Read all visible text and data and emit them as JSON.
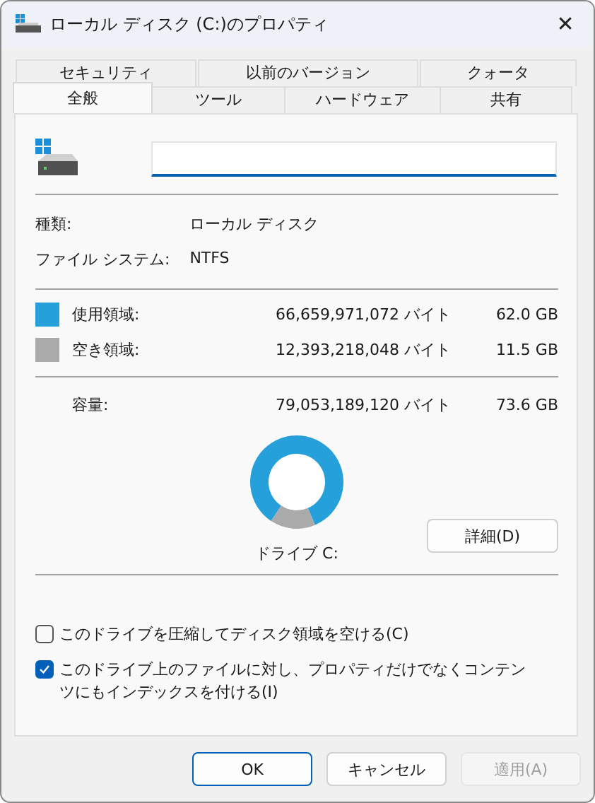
{
  "window": {
    "title": "ローカル ディスク (C:)のプロパティ",
    "close": "✕"
  },
  "tabs": [
    [
      {
        "label": "セキュリティ",
        "selected": false
      },
      {
        "label": "以前のバージョン",
        "selected": false
      },
      {
        "label": "クォータ",
        "selected": false
      }
    ],
    [
      {
        "label": "全般",
        "selected": true
      },
      {
        "label": "ツール",
        "selected": false
      },
      {
        "label": "ハードウェア",
        "selected": false
      },
      {
        "label": "共有",
        "selected": false
      }
    ]
  ],
  "general": {
    "info": [
      {
        "label": "種類:",
        "value": "ローカル ディスク"
      },
      {
        "label": "ファイル システム:",
        "value": "NTFS"
      }
    ],
    "space": [
      {
        "label": "使用領域:",
        "bytes": "66,659,971,072 バイト",
        "size": "62.0 GB",
        "color": "#26a0da"
      },
      {
        "label": "空き領域:",
        "bytes": "12,393,218,048 バイト",
        "size": "11.5 GB",
        "color": "#aaaaaa"
      }
    ],
    "capacity": {
      "label": "容量:",
      "bytes": "79,053,189,120 バイト",
      "size": "73.6 GB"
    },
    "chart_data": {
      "type": "donut",
      "series": [
        {
          "values": [
            84.3,
            15.7
          ]
        }
      ]
    },
    "drive_label": "ドライブ C:",
    "details_button": "詳細(D)",
    "options": [
      {
        "label": "このドライブを圧縮してディスク領域を空ける(C)",
        "checked": false
      },
      {
        "label": "このドライブ上のファイルに対し、プロパティだけでなくコンテンツにもインデックスを付ける(I)",
        "checked": true
      }
    ]
  },
  "buttons": [
    {
      "label": "OK",
      "default": true,
      "disabled": false
    },
    {
      "label": "キャンセル",
      "default": false,
      "disabled": false
    },
    {
      "label": "適用(A)",
      "default": false,
      "disabled": true
    }
  ]
}
